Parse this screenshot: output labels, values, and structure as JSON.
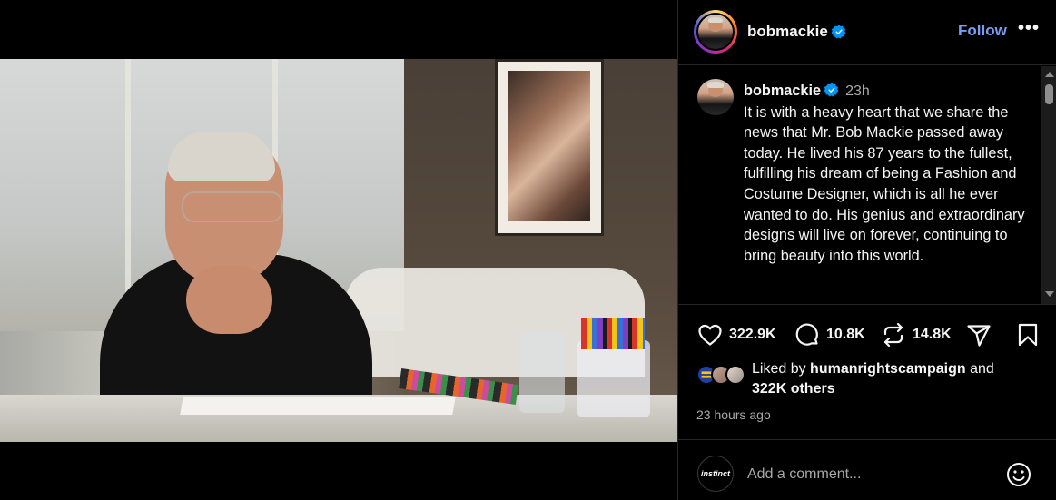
{
  "header": {
    "username": "bobmackie",
    "follow_label": "Follow",
    "more_label": "•••"
  },
  "caption": {
    "username": "bobmackie",
    "time": "23h",
    "text": "It is with a heavy heart that we share the news that Mr. Bob Mackie passed away today. He lived his 87 years to the fullest, fulfilling his dream of being a Fashion and Costume Designer, which is all he ever wanted to do. His genius and extraordinary designs will live on forever, continuing to bring beauty into this world."
  },
  "actions": {
    "likes": "322.9K",
    "comments": "10.8K",
    "reposts": "14.8K"
  },
  "liked_by": {
    "prefix": "Liked by",
    "user": "humanrightscampaign",
    "connector": "and",
    "others": "322K others"
  },
  "timestamp": "23 hours ago",
  "comment": {
    "avatar_label": "instinct",
    "placeholder": "Add a comment..."
  },
  "colors": {
    "accent": "#7a9cf5",
    "verified": "#0095f6",
    "background": "#000000",
    "muted": "#a8a8a8"
  },
  "icons": {
    "like": "heart-icon",
    "comment": "comment-bubble-icon",
    "repost": "repost-icon",
    "share": "send-icon",
    "save": "bookmark-icon",
    "emoji": "smiley-icon"
  }
}
